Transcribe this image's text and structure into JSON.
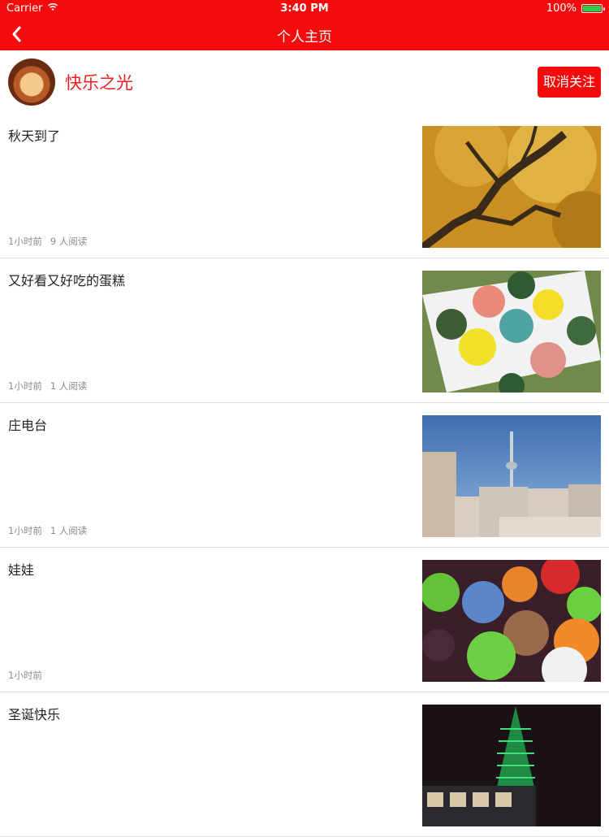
{
  "status_bar": {
    "carrier": "Carrier",
    "time": "3:40 PM",
    "battery": "100%"
  },
  "nav": {
    "title": "个人主页",
    "back_icon": "chevron-left-icon"
  },
  "profile": {
    "username": "快乐之光",
    "unfollow_label": "取消关注"
  },
  "feed": [
    {
      "title": "秋天到了",
      "time": "1小时前",
      "reads": "9 人阅读",
      "thumbnail": "autumn-tree-photo"
    },
    {
      "title": "又好看又好吃的蛋糕",
      "time": "1小时前",
      "reads": "1 人阅读",
      "thumbnail": "cupcakes-photo"
    },
    {
      "title": "庄电台",
      "time": "1小时前",
      "reads": "1 人阅读",
      "thumbnail": "tv-tower-city-photo"
    },
    {
      "title": "娃娃",
      "time": "1小时前",
      "reads": "",
      "thumbnail": "plush-toys-photo"
    },
    {
      "title": "圣诞快乐",
      "time": "",
      "reads": "",
      "thumbnail": "christmas-tower-night-photo"
    }
  ],
  "colors": {
    "brand_red": "#f40c0c",
    "username_red": "#f02020",
    "battery_green": "#2bd04a"
  }
}
